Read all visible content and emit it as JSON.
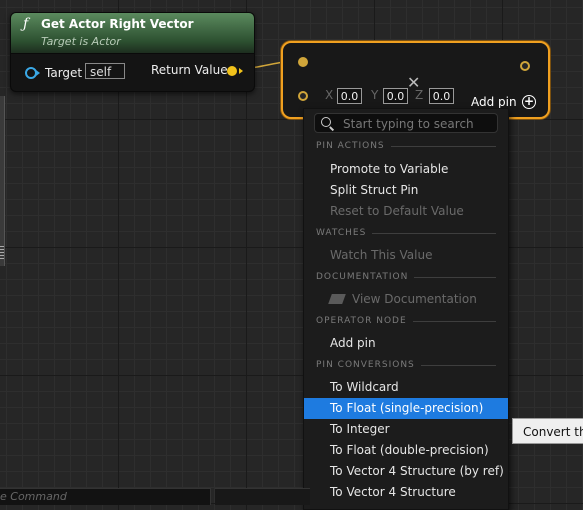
{
  "function_node": {
    "icon": "function-icon",
    "title": "Get Actor Right Vector",
    "subtitle": "Target is Actor",
    "target_label": "Target",
    "target_value": "self",
    "return_label": "Return Value"
  },
  "vector_node": {
    "x_label": "X",
    "x_value": "0.0",
    "y_label": "Y",
    "y_value": "0.0",
    "z_label": "Z",
    "z_value": "0.0",
    "add_pin_label": "Add pin",
    "add_pin_icon": "plus-circle-icon"
  },
  "menu": {
    "search_placeholder": "Start typing to search",
    "sections": {
      "pin_actions": "PIN ACTIONS",
      "watches": "WATCHES",
      "documentation": "DOCUMENTATION",
      "operator_node": "OPERATOR NODE",
      "pin_conversions": "PIN CONVERSIONS"
    },
    "items": {
      "promote": "Promote to Variable",
      "split": "Split Struct Pin",
      "reset": "Reset to Default Value",
      "watch": "Watch This Value",
      "view_doc": "View Documentation",
      "add_pin": "Add pin",
      "to_wildcard": "To Wildcard",
      "to_float_single": "To Float (single-precision)",
      "to_integer": "To Integer",
      "to_float_double": "To Float (double-precision)",
      "to_vector4_ref": "To Vector 4 Structure (by ref)",
      "to_vector4": "To Vector 4 Structure"
    }
  },
  "tooltip": "Convert this",
  "command_bar": "e Command",
  "colors": {
    "selection_border": "#f0a020",
    "highlight": "#1e7be0",
    "vector_pin": "#d1a63a",
    "return_pin": "#f1c21b",
    "target_pin": "#3aa8e6"
  }
}
